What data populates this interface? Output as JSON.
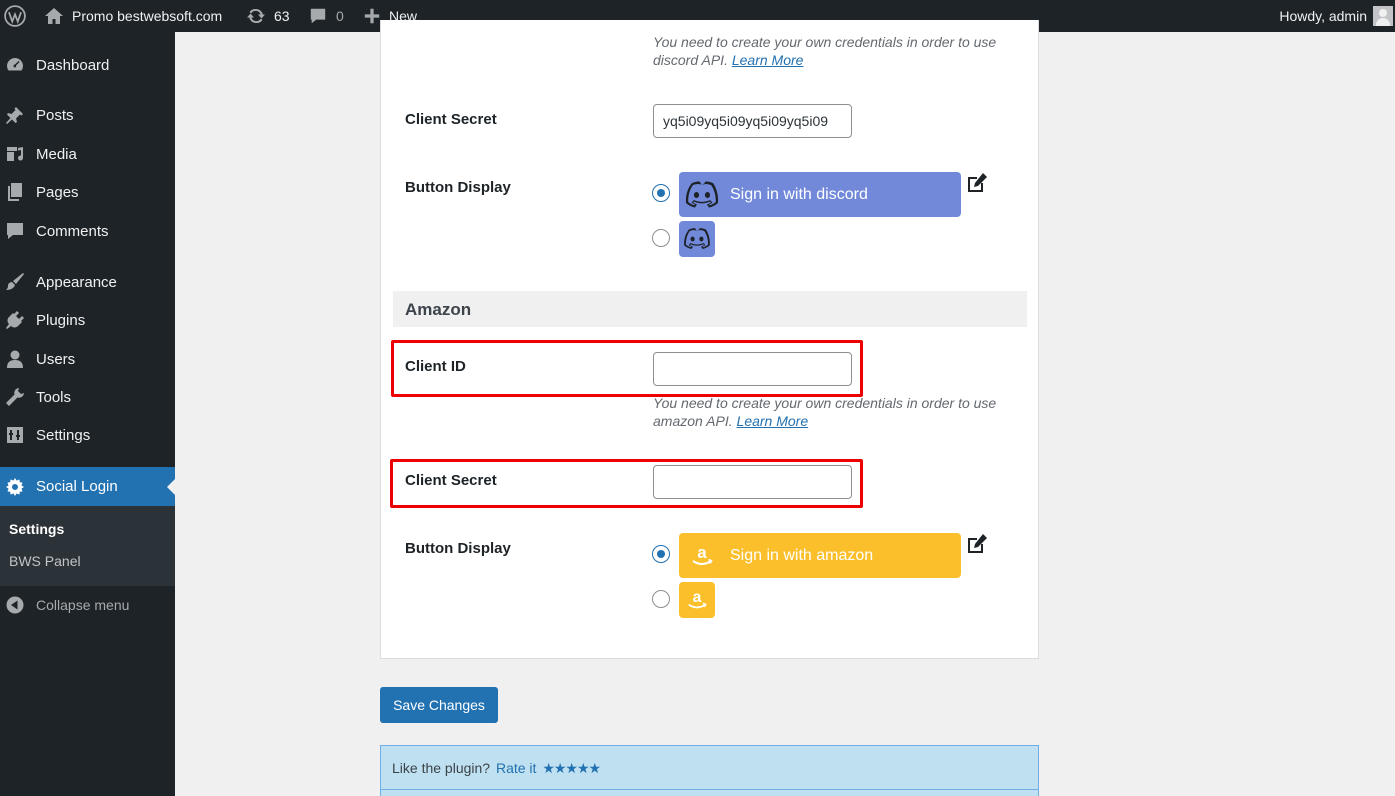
{
  "adminbar": {
    "site_name": "Promo bestwebsoft.com",
    "updates_count": "63",
    "comments_count": "0",
    "new_label": "New",
    "greeting": "Howdy, admin"
  },
  "sidebar": {
    "items": [
      {
        "label": "Dashboard",
        "icon": "dashboard-icon"
      },
      {
        "label": "Posts",
        "icon": "pin-icon"
      },
      {
        "label": "Media",
        "icon": "media-icon"
      },
      {
        "label": "Pages",
        "icon": "pages-icon"
      },
      {
        "label": "Comments",
        "icon": "comment-icon"
      },
      {
        "label": "Appearance",
        "icon": "brush-icon"
      },
      {
        "label": "Plugins",
        "icon": "plugin-icon"
      },
      {
        "label": "Users",
        "icon": "user-icon"
      },
      {
        "label": "Tools",
        "icon": "wrench-icon"
      },
      {
        "label": "Settings",
        "icon": "settings-icon"
      },
      {
        "label": "Social Login",
        "icon": "gear-icon"
      }
    ],
    "submenu": [
      "Settings",
      "BWS Panel"
    ],
    "collapse_label": "Collapse menu"
  },
  "discord": {
    "desc_text": "You need to create your own credentials in order to use discord API.",
    "learn_more": "Learn More",
    "client_secret_label": "Client Secret",
    "client_secret_value": "yq5i09yq5i09yq5i09yq5i09",
    "button_display_label": "Button Display",
    "button_text": "Sign in with discord"
  },
  "amazon": {
    "section_title": "Amazon",
    "client_id_label": "Client ID",
    "client_id_value": "",
    "desc_text": "You need to create your own credentials in order to use amazon API.",
    "learn_more": "Learn More",
    "client_secret_label": "Client Secret",
    "client_secret_value": "",
    "button_display_label": "Button Display",
    "button_text": "Sign in with amazon"
  },
  "footer": {
    "save_label": "Save Changes",
    "rate_prompt": "Like the plugin?",
    "rate_link": "Rate it",
    "stars": "★★★★★"
  },
  "colors": {
    "admin_dark": "#1d2327",
    "accent": "#2271b1",
    "discord": "#7289da",
    "amazon": "#fbbf2c",
    "highlight": "#e00000"
  }
}
